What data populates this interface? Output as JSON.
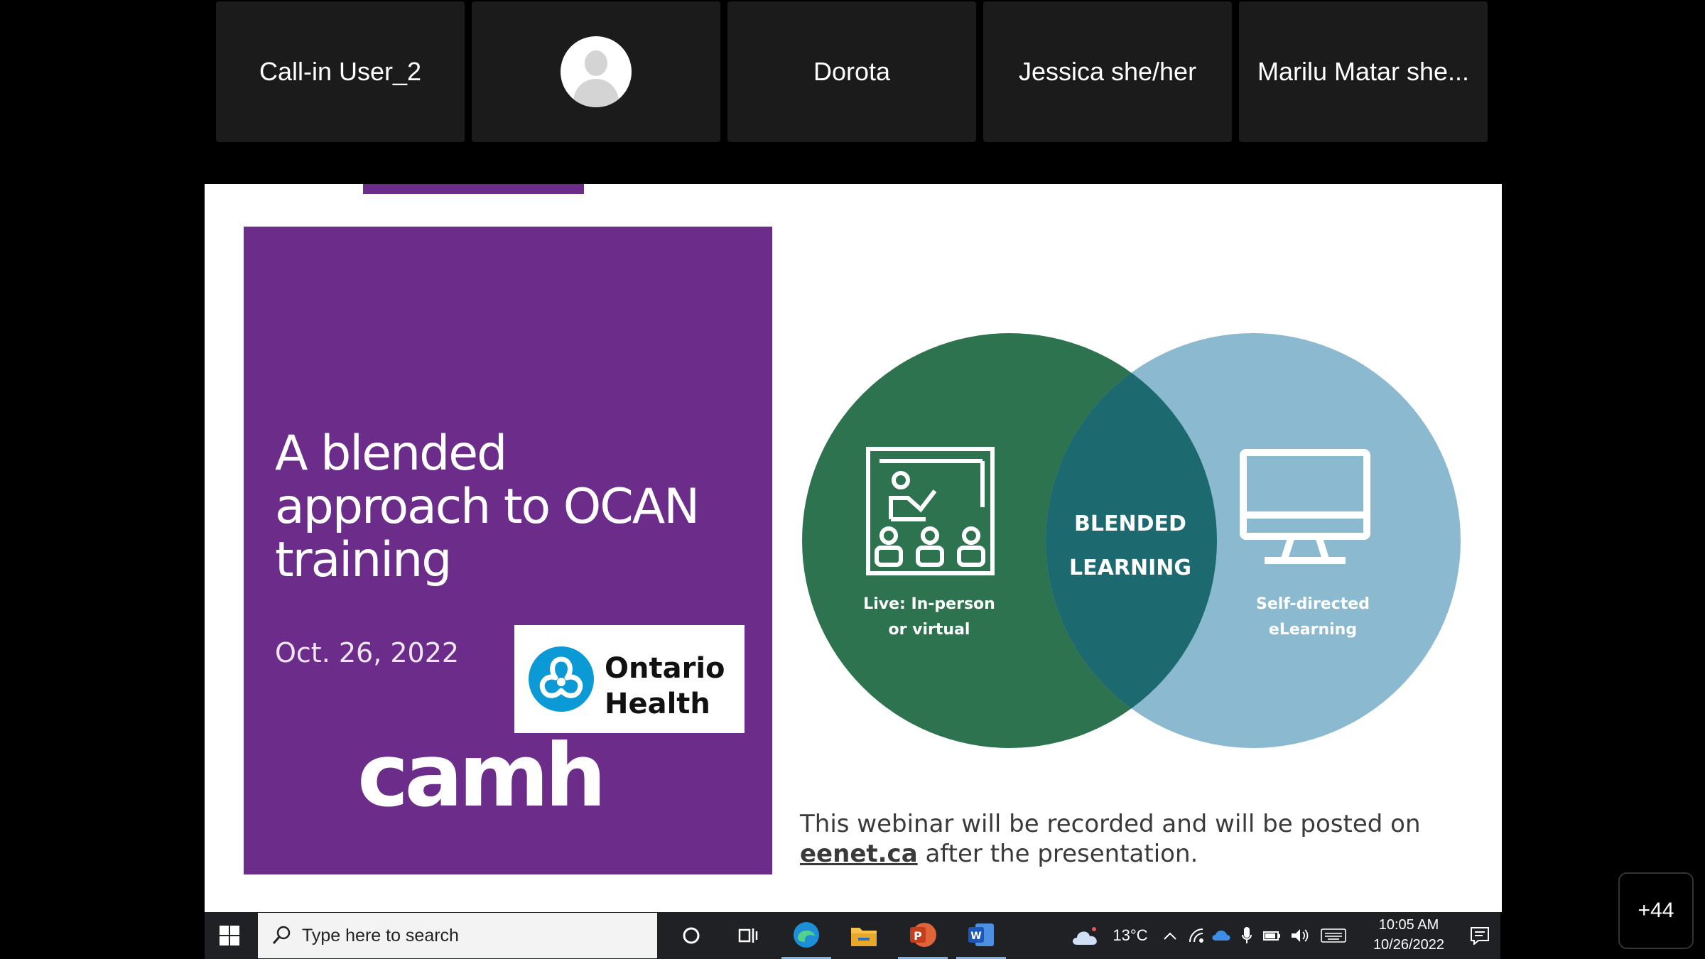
{
  "participants": [
    {
      "name": "Call-in User_2",
      "avatar": false
    },
    {
      "name": "",
      "avatar": true
    },
    {
      "name": "Dorota",
      "avatar": false
    },
    {
      "name": "Jessica she/her",
      "avatar": false
    },
    {
      "name": "Marilu Matar she...",
      "avatar": false
    }
  ],
  "slide": {
    "title": "A blended approach to OCAN training",
    "date": "Oct. 26, 2022",
    "ontario_health_line1": "Ontario",
    "ontario_health_line2": "Health",
    "camh": "camh",
    "venn": {
      "left_label_1": "Live: In-person",
      "left_label_2": "or virtual",
      "center_label_1": "BLENDED",
      "center_label_2": "LEARNING",
      "right_label_1": "Self-directed",
      "right_label_2": "eLearning"
    },
    "note_prefix": "This webinar will be recorded and will be posted on",
    "note_link": "eenet.ca",
    "note_suffix": "after the presentation."
  },
  "taskbar": {
    "search_placeholder": "Type here to search",
    "weather_temp": "13°C",
    "time": "10:05 AM",
    "date": "10/26/2022"
  },
  "more_participants": "+44",
  "colors": {
    "purple": "#6b2c8a",
    "venn_green": "#2e7350",
    "venn_blue": "#8bb9cf",
    "venn_overlap": "#1c6a70"
  }
}
